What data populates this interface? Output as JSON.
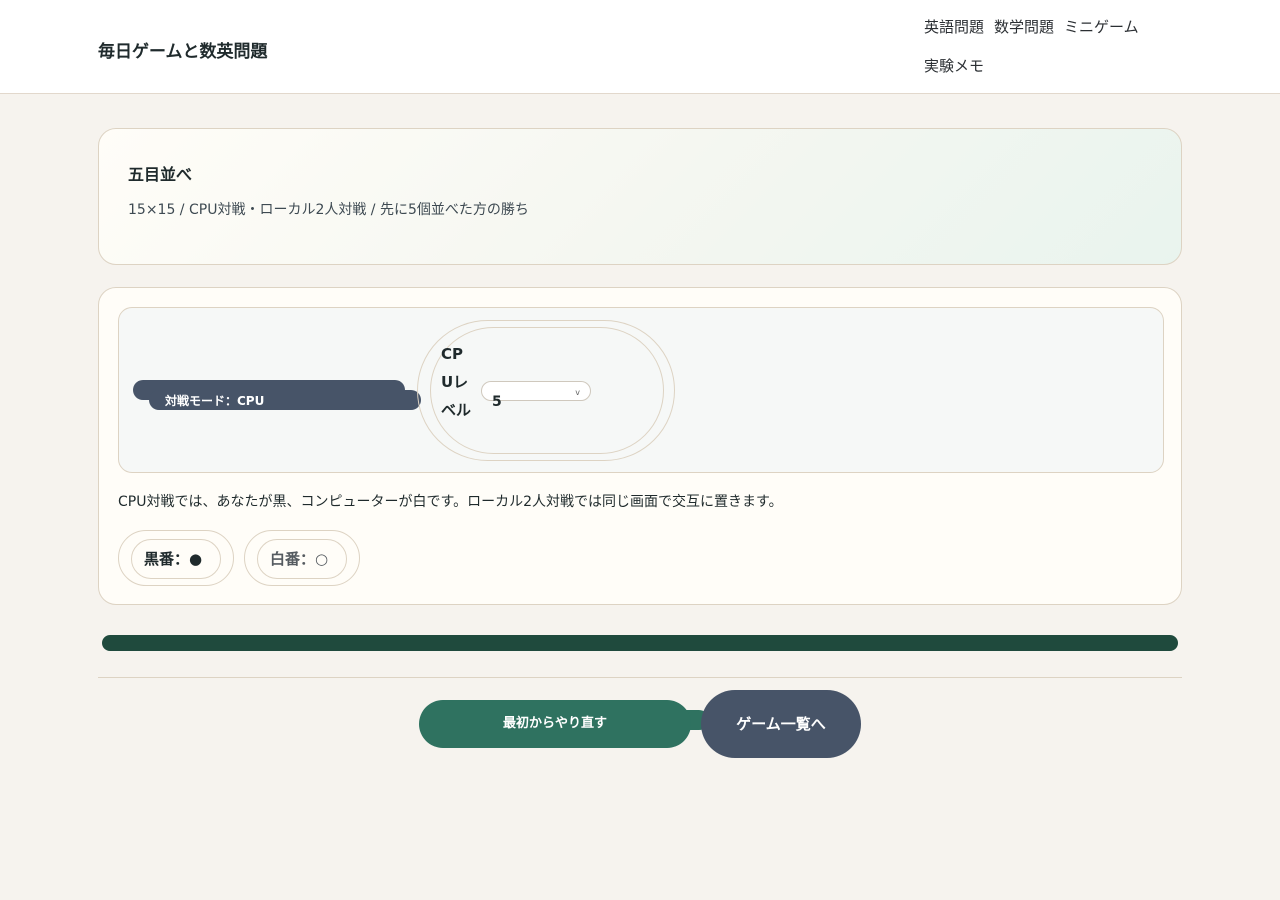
{
  "header": {
    "site_title": "毎日ゲームと数英問題",
    "nav": [
      "英語問題",
      "数学問題",
      "ミニゲーム",
      "実験メモ"
    ]
  },
  "hero": {
    "title": "五目並べ",
    "description": "15×15 / CPU対戦・ローカル2人対戦 / 先に5個並べた方の勝ち"
  },
  "controls": {
    "mode_button": "対戦モード：CPU",
    "level_label": "CPUレベル",
    "level_value": "5",
    "level_chevron": "v"
  },
  "note": "CPU対戦では、あなたが黒、コンピューターが白です。ローカル2人対戦では同じ画面で交互に置きます。",
  "turns": {
    "black": "黒番：●",
    "white": "白番：○"
  },
  "actions": {
    "restart": "最初からやり直す",
    "game_list": "ゲーム一覧へ"
  },
  "colors": {
    "accent_green": "#2f7260",
    "slate": "#475468",
    "progress": "#1f4a3d"
  }
}
